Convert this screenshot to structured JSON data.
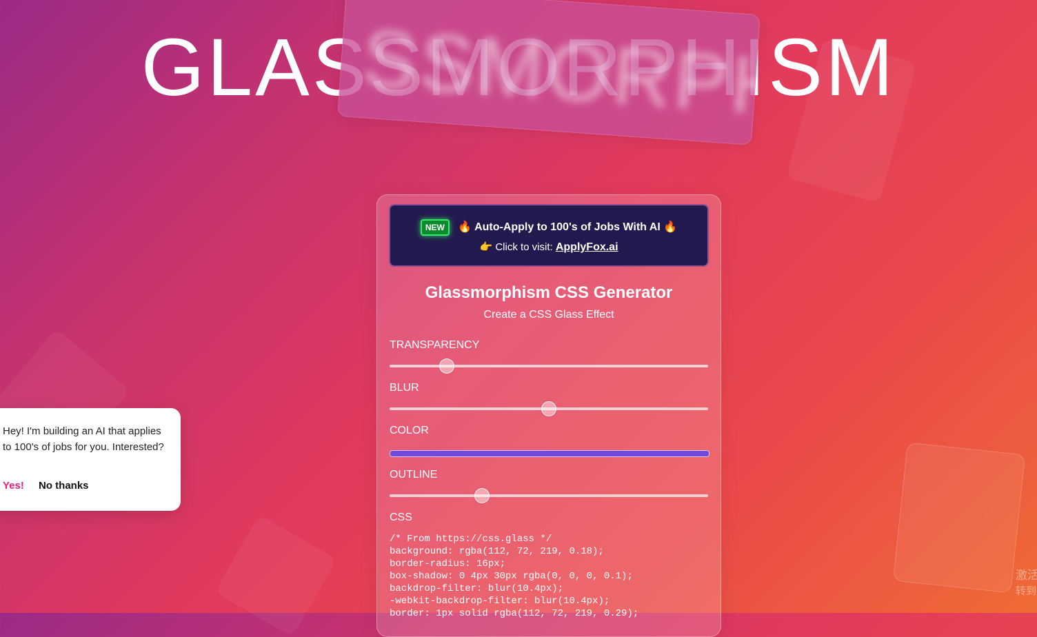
{
  "hero": {
    "title": "GLASSMORPHISM"
  },
  "banner": {
    "badge": "NEW",
    "fire_icon": "🔥",
    "headline": "Auto-Apply to 100's of Jobs With AI",
    "pointer_icon": "👉",
    "cta_prefix": "Click to visit:",
    "cta_link": "ApplyFox.ai"
  },
  "generator": {
    "title": "Glassmorphism CSS Generator",
    "subtitle": "Create a CSS Glass Effect",
    "transparency_label": "TRANSPARENCY",
    "transparency_value": 0.18,
    "blur_label": "BLUR",
    "blur_value": 0.5,
    "color_label": "COLOR",
    "color_value": "#7048db",
    "outline_label": "OUTLINE",
    "outline_value": 0.29,
    "css_label": "CSS",
    "css_code": "/* From https://css.glass */\nbackground: rgba(112, 72, 219, 0.18);\nborder-radius: 16px;\nbox-shadow: 0 4px 30px rgba(0, 0, 0, 0.1);\nbackdrop-filter: blur(10.4px);\n-webkit-backdrop-filter: blur(10.4px);\nborder: 1px solid rgba(112, 72, 219, 0.29);"
  },
  "popup": {
    "message": "Hey! I'm building an AI that applies to 100's of jobs for you. Interested?",
    "yes_label": "Yes!",
    "no_label": "No thanks"
  },
  "watermark": {
    "line1": "激活",
    "line2": "转到"
  },
  "colors": {
    "accent_yes": "#e0207a",
    "banner_bg": "#221a4e",
    "badge_green": "#0d8a2e"
  }
}
